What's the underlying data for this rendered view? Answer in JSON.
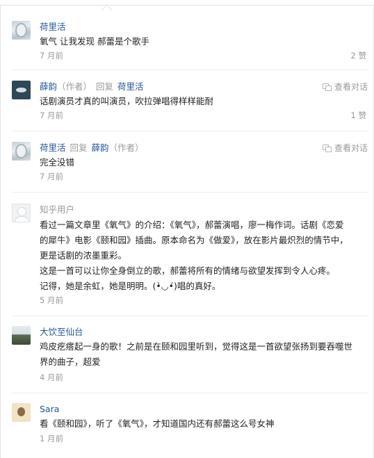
{
  "comments": [
    {
      "author": "荷里活",
      "body": [
        "氧气 让我发现 郝蕾是个歌手"
      ],
      "time": "7 月前",
      "likes": "2 赞"
    },
    {
      "author": "薛韵",
      "author_tag": "（作者）",
      "reply_word": "回复",
      "reply_to": "荷里活",
      "view_conversation": "查看对话",
      "body": [
        "话剧演员才真的叫演员，吹拉弹唱得样样能耐"
      ],
      "time": "7 月前",
      "likes": "1 赞"
    },
    {
      "author": "荷里活",
      "reply_word": "回复",
      "reply_to": "薛韵",
      "reply_to_tag": "（作者）",
      "view_conversation": "查看对话",
      "body": [
        "完全没错"
      ],
      "time": "7 月前"
    },
    {
      "author": "知乎用户",
      "body": [
        "看过一篇文章里《氧气》的介绍：《氧气》，郝蕾演唱，廖一梅作词。话剧《恋爱",
        "的犀牛》电影《颐和园》插曲。原本命名为《做爱》，放在影片最炽烈的情节中，",
        "更是话剧的浓墨重彩。",
        "这是一首可以让你全身倒立的歌，郝蕾将所有的情绪与欲望发挥到令人心疼。",
        "记得，她是余虹，她是明明。(•̀◡•́)唱的真好。"
      ],
      "time": "5 月前"
    },
    {
      "author": "大饮至仙台",
      "body": [
        "鸡皮疙瘩起一身的歌！之前是在颐和园里听到，觉得这是一首欲望张扬到要吞噬世",
        "界的曲子，超爱"
      ],
      "time": "4 月前"
    },
    {
      "author": "Sara",
      "body": [
        "看《颐和园》，听了《氧气》，才知道国内还有郝蕾这么号女神"
      ],
      "time": "1 月前"
    }
  ],
  "colors": {
    "author_link": "#225599",
    "muted": "#999999",
    "divider": "#ececec"
  },
  "icons": {
    "conversation": "conversation-icon"
  }
}
